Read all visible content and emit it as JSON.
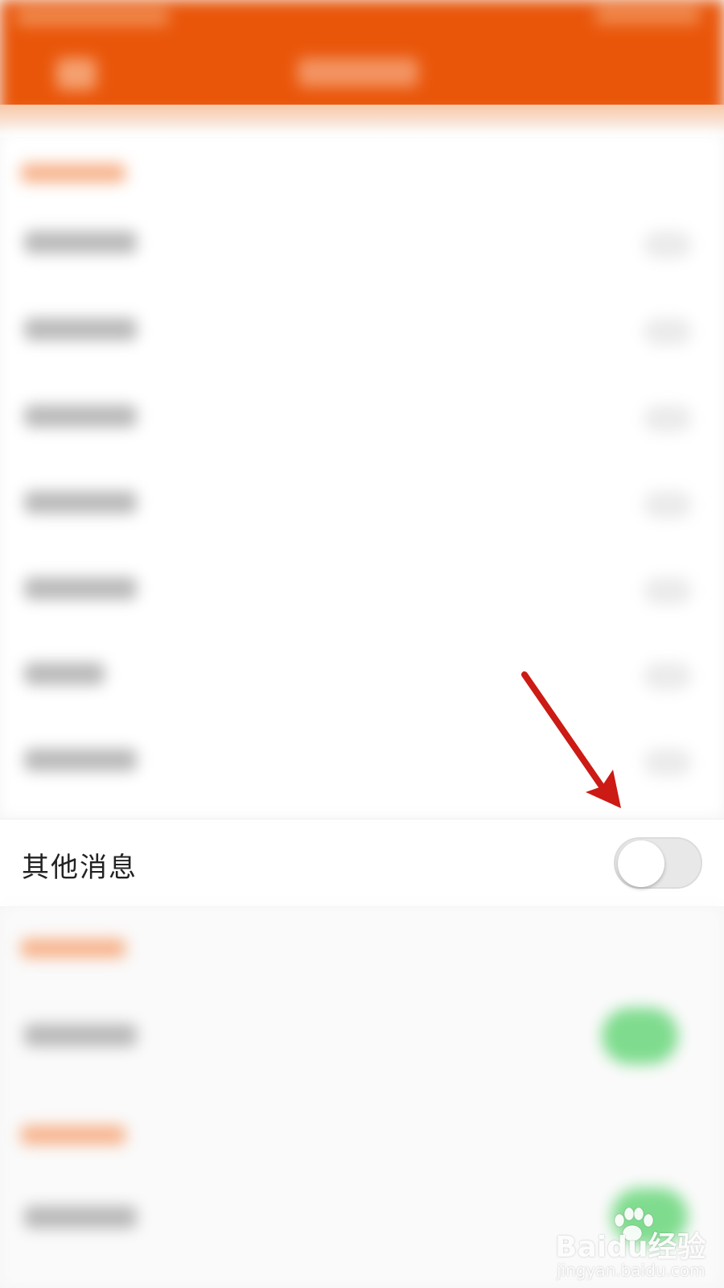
{
  "setting_row": {
    "label": "其他消息",
    "toggle_state": "off"
  },
  "watermark": {
    "brand": "Baidu经验",
    "url": "jingyan.baidu.com"
  },
  "colors": {
    "header": "#e9560a",
    "toggle_off": "#e8e8e8",
    "toggle_on": "#7fdc8e",
    "annotation_arrow": "#cc1a14"
  },
  "icons": [
    "back-arrow-icon",
    "annotation-arrow-icon",
    "baidu-paw-icon"
  ]
}
